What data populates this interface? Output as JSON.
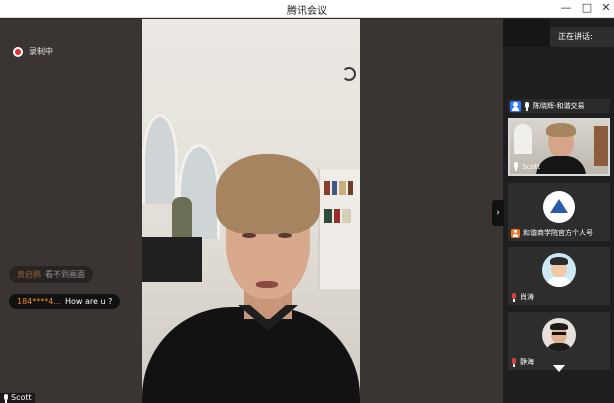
{
  "window": {
    "title": "腾讯会议"
  },
  "recording": {
    "label": "录制中"
  },
  "speaking": {
    "label": "正在讲话:"
  },
  "chat": [
    {
      "sender": "黄启鹏",
      "message": "看不到画面",
      "faded": true
    },
    {
      "sender": "184****4...",
      "message": "How are u ?",
      "faded": false
    }
  ],
  "main_speaker": {
    "name": "Scott"
  },
  "member_header": {
    "label": "陈晓辉-和谐交易"
  },
  "participants": [
    {
      "name": "Scott",
      "mic": "on"
    },
    {
      "name": "和谐商学院官方个人号",
      "mic": "host"
    },
    {
      "name": "肖涛",
      "mic": "muted"
    },
    {
      "name": "静海",
      "mic": "muted"
    }
  ],
  "colors": {
    "recording_dot": "#e32d2d",
    "chat_sender": "#f28a2a",
    "host_badge": "#f0782a",
    "user_badge": "#2f7cf6"
  }
}
